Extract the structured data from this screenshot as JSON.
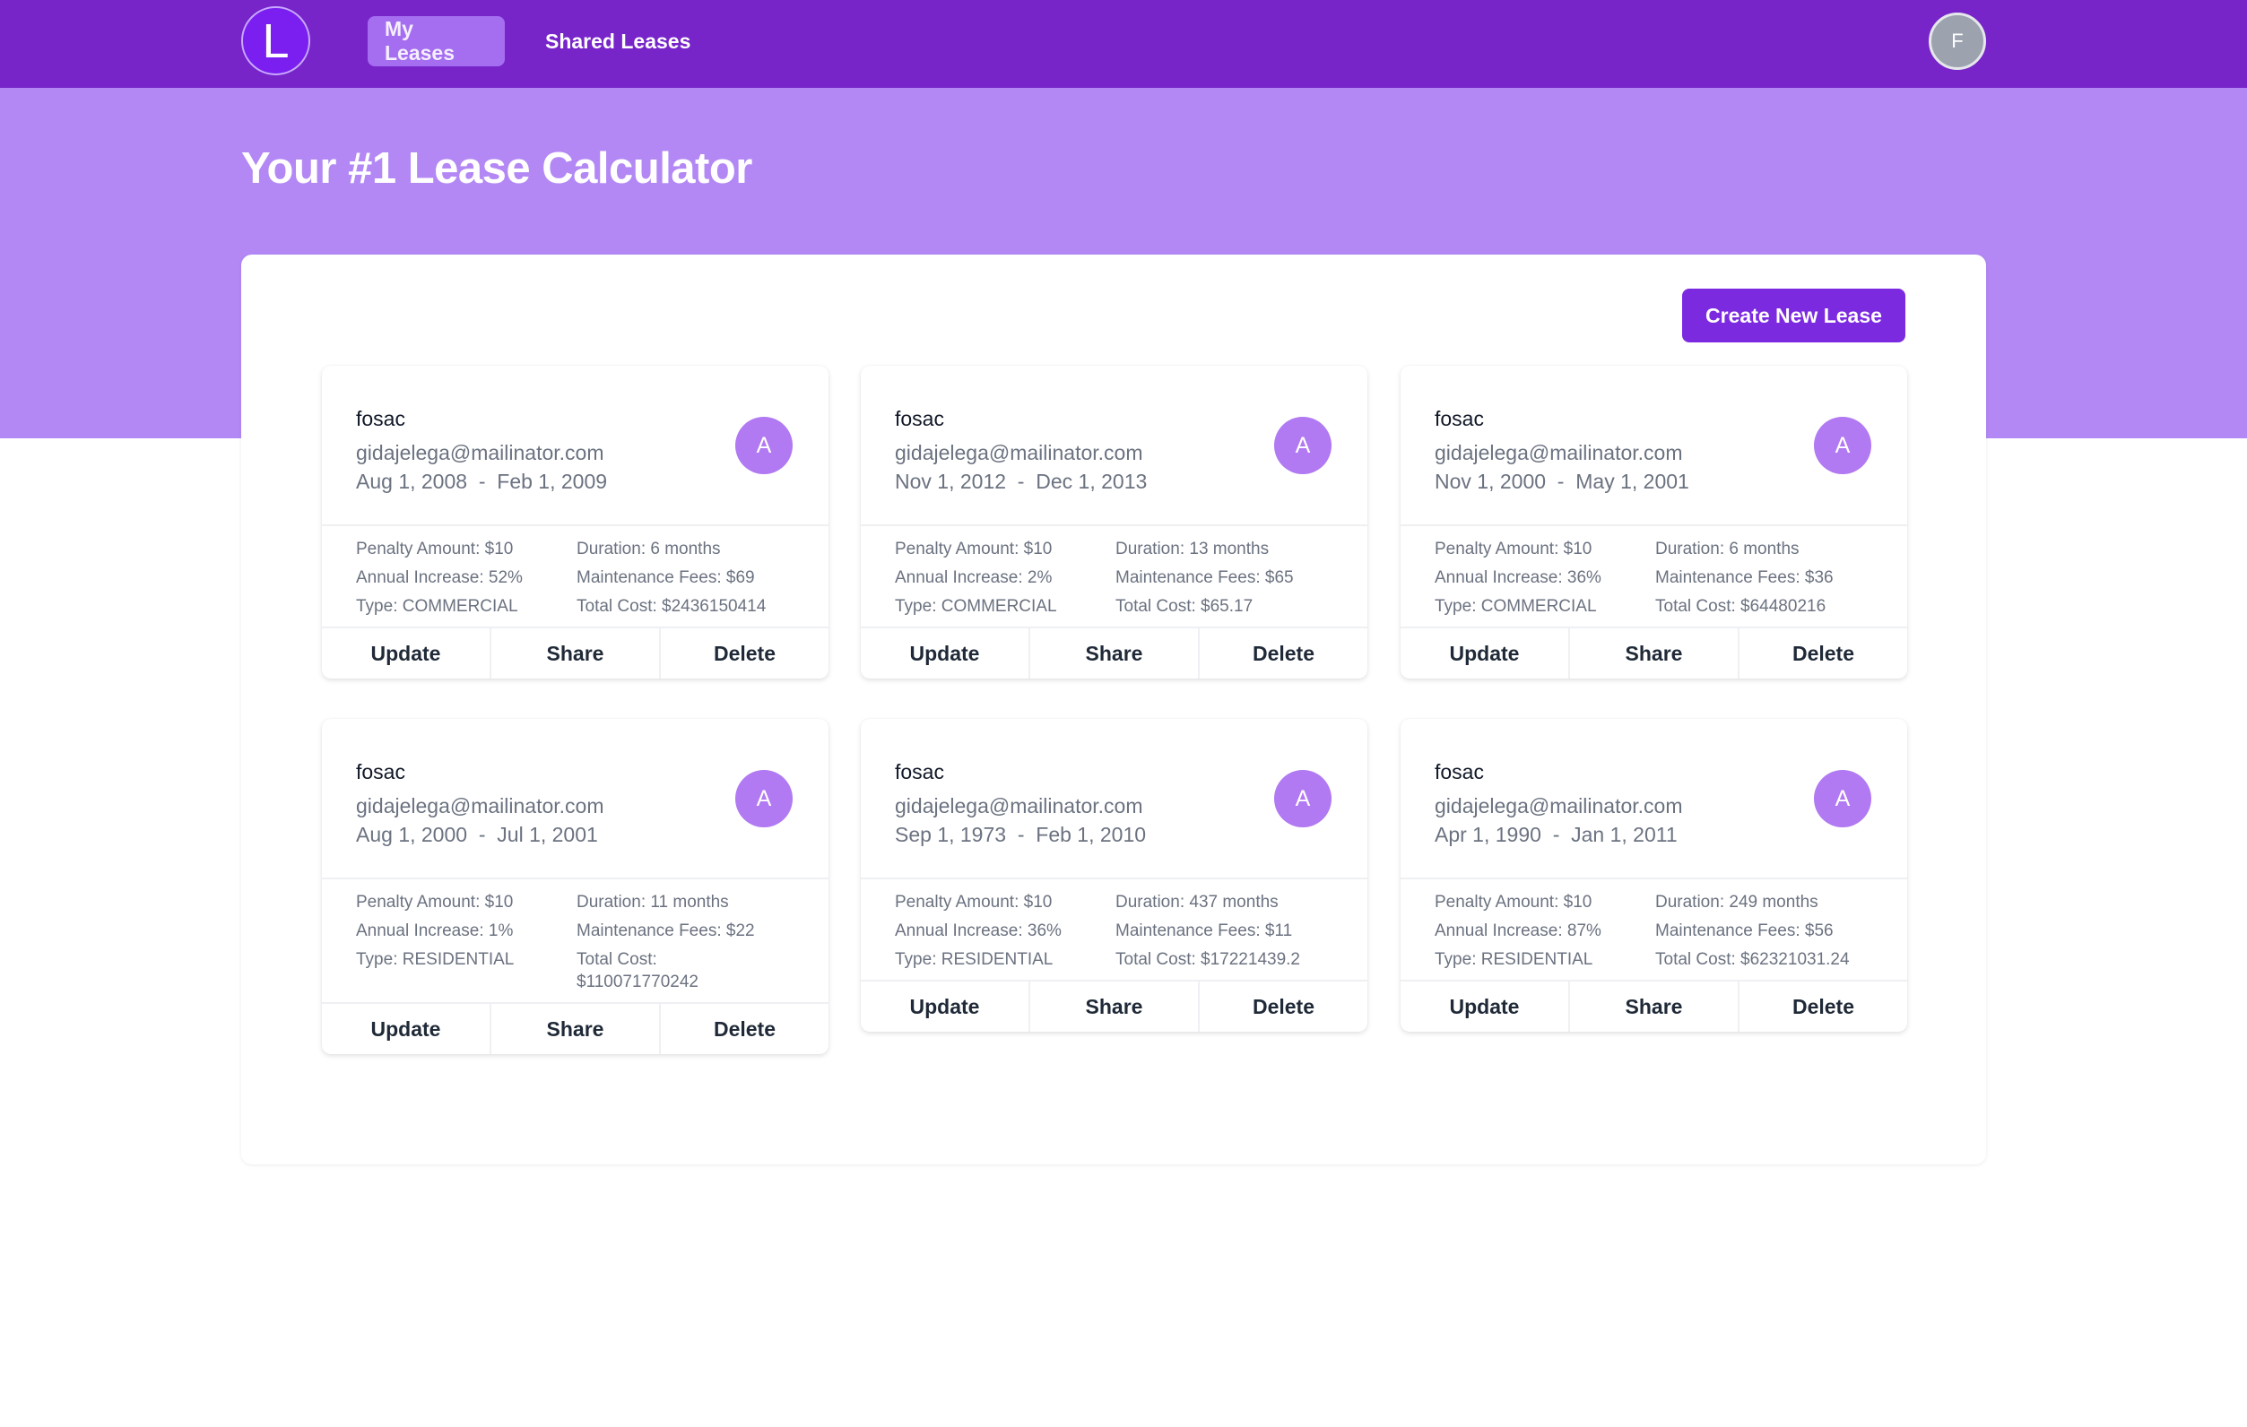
{
  "nav": {
    "logo_letter": "L",
    "links": [
      "My Leases",
      "Shared Leases"
    ],
    "active": "My Leases",
    "user_initial": "F"
  },
  "page_title": "Your #1 Lease Calculator",
  "create_button": "Create New Lease",
  "labels": {
    "update": "Update",
    "share": "Share",
    "delete": "Delete"
  },
  "colors": {
    "navbar": "#7724c9",
    "hero": "#b388f5",
    "primary_button": "#7c2ae0",
    "card_avatar": "#b179f2"
  },
  "leases": [
    {
      "name": "fosac",
      "email": "gidajelega@mailinator.com",
      "dates": "Aug 1, 2008  -  Feb 1, 2009",
      "avatar": "A",
      "penalty": "Penalty Amount: $10",
      "duration": "Duration: 6 months",
      "increase": "Annual Increase: 52%",
      "fees": "Maintenance Fees: $69",
      "type": "Type: COMMERCIAL",
      "total": "Total Cost: $2436150414"
    },
    {
      "name": "fosac",
      "email": "gidajelega@mailinator.com",
      "dates": "Nov 1, 2012  -  Dec 1, 2013",
      "avatar": "A",
      "penalty": "Penalty Amount: $10",
      "duration": "Duration: 13 months",
      "increase": "Annual Increase: 2%",
      "fees": "Maintenance Fees: $65",
      "type": "Type: COMMERCIAL",
      "total": "Total Cost: $65.17"
    },
    {
      "name": "fosac",
      "email": "gidajelega@mailinator.com",
      "dates": "Nov 1, 2000  -  May 1, 2001",
      "avatar": "A",
      "penalty": "Penalty Amount: $10",
      "duration": "Duration: 6 months",
      "increase": "Annual Increase: 36%",
      "fees": "Maintenance Fees: $36",
      "type": "Type: COMMERCIAL",
      "total": "Total Cost: $64480216"
    },
    {
      "name": "fosac",
      "email": "gidajelega@mailinator.com",
      "dates": "Aug 1, 2000  -  Jul 1, 2001",
      "avatar": "A",
      "penalty": "Penalty Amount: $10",
      "duration": "Duration: 11 months",
      "increase": "Annual Increase: 1%",
      "fees": "Maintenance Fees: $22",
      "type": "Type: RESIDENTIAL",
      "total": "Total Cost: $110071770242"
    },
    {
      "name": "fosac",
      "email": "gidajelega@mailinator.com",
      "dates": "Sep 1, 1973  -  Feb 1, 2010",
      "avatar": "A",
      "penalty": "Penalty Amount: $10",
      "duration": "Duration: 437 months",
      "increase": "Annual Increase: 36%",
      "fees": "Maintenance Fees: $11",
      "type": "Type: RESIDENTIAL",
      "total": "Total Cost: $17221439.2"
    },
    {
      "name": "fosac",
      "email": "gidajelega@mailinator.com",
      "dates": "Apr 1, 1990  -  Jan 1, 2011",
      "avatar": "A",
      "penalty": "Penalty Amount: $10",
      "duration": "Duration: 249 months",
      "increase": "Annual Increase: 87%",
      "fees": "Maintenance Fees: $56",
      "type": "Type: RESIDENTIAL",
      "total": "Total Cost: $62321031.24"
    }
  ]
}
